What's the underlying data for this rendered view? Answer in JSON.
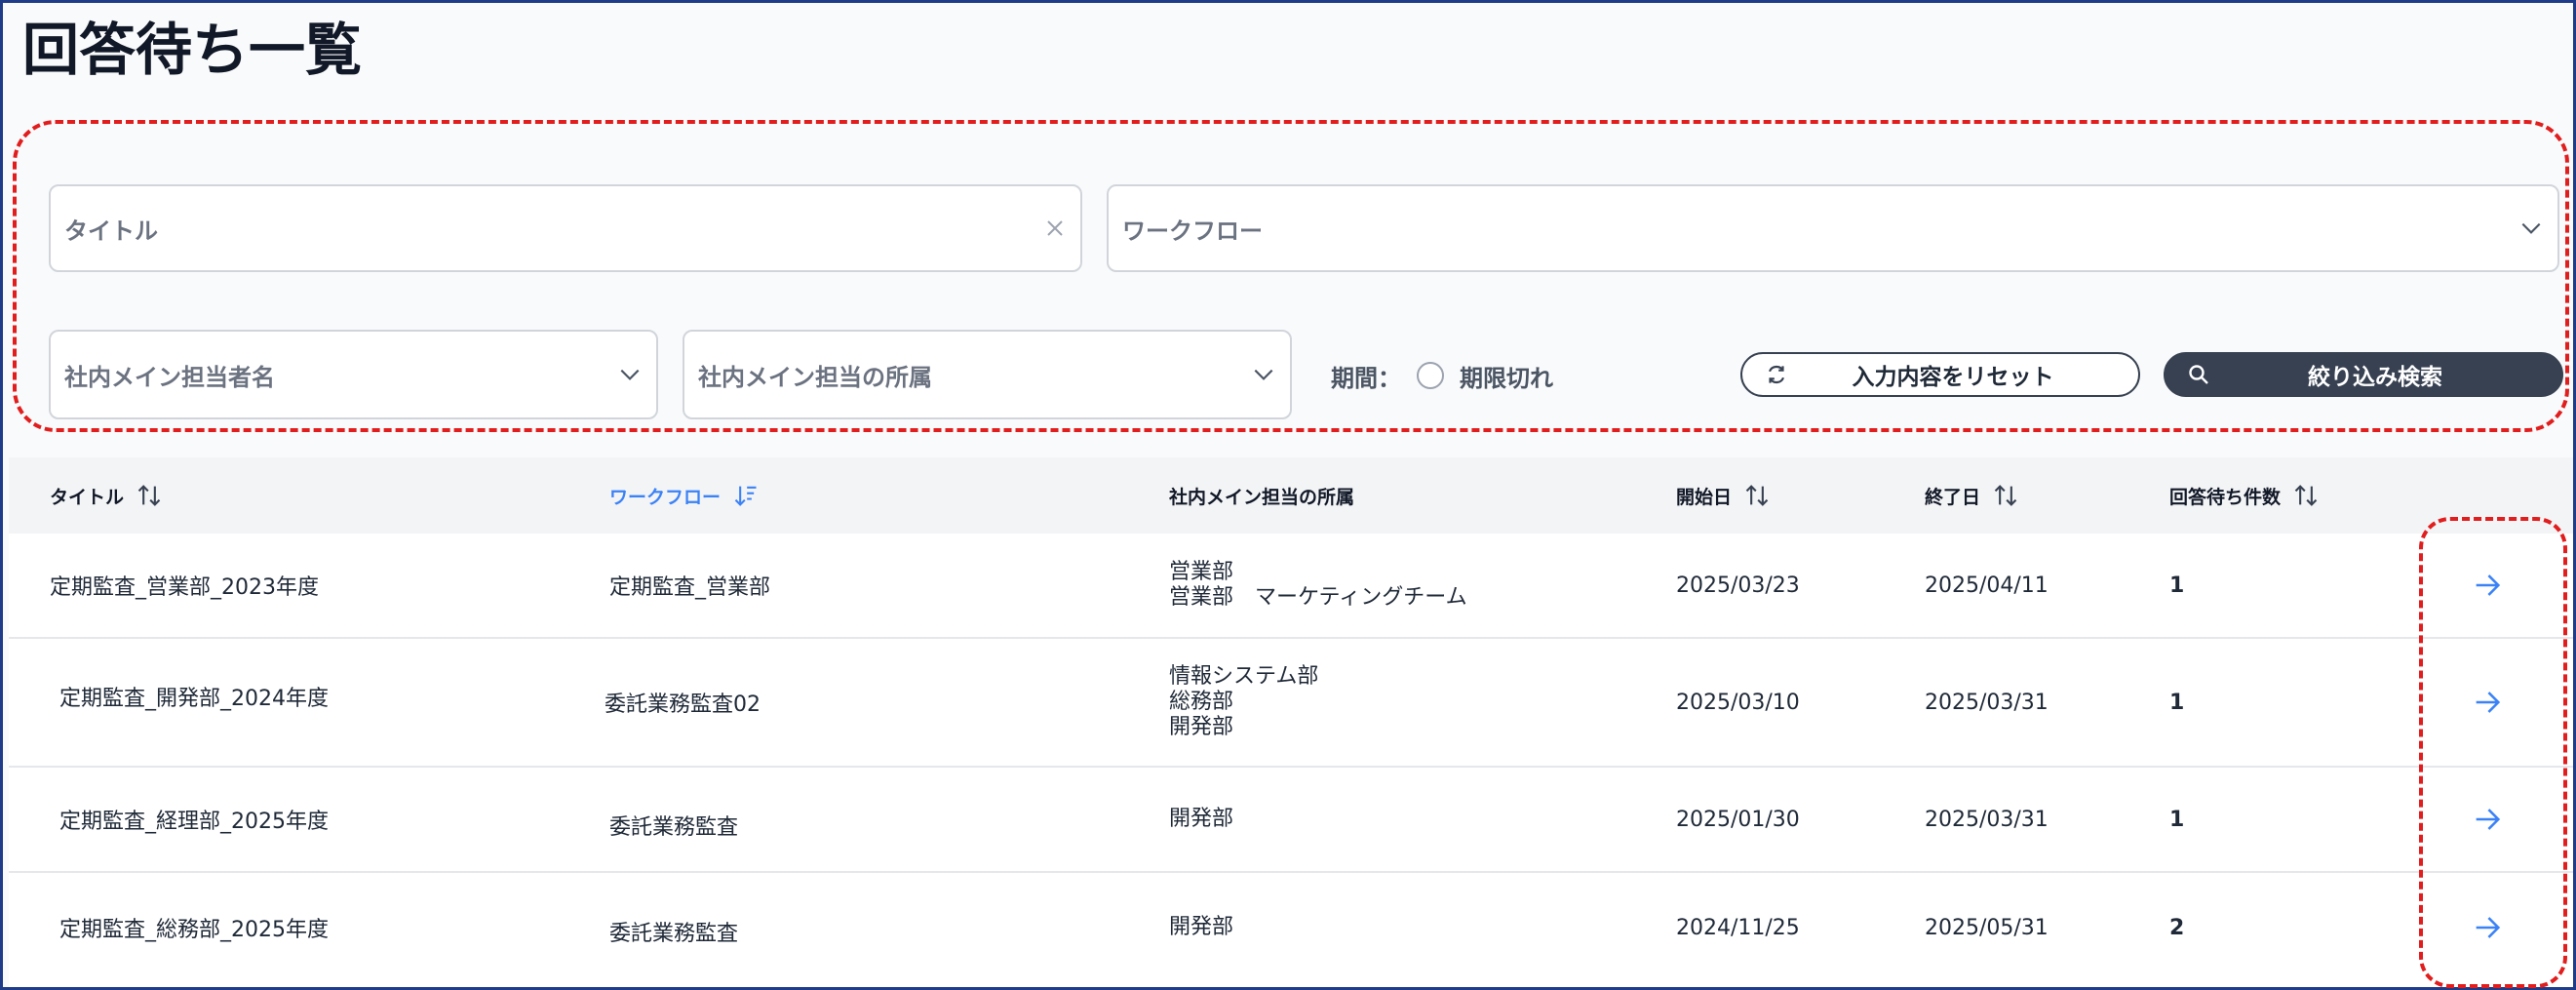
{
  "page": {
    "title": "回答待ち一覧"
  },
  "filters": {
    "title_placeholder": "タイトル",
    "workflow_placeholder": "ワークフロー",
    "owner_placeholder": "社内メイン担当者名",
    "dept_placeholder": "社内メイン担当の所属",
    "period_label": "期間：",
    "expired_label": "期限切れ",
    "reset_label": "入力内容をリセット",
    "search_label": "絞り込み検索"
  },
  "table": {
    "headers": {
      "title": "タイトル",
      "workflow": "ワークフロー",
      "dept": "社内メイン担当の所属",
      "start": "開始日",
      "end": "終了日",
      "count": "回答待ち件数"
    },
    "rows": [
      {
        "title": "定期監査_営業部_2023年度",
        "workflow": "定期監査_営業部",
        "depts": [
          "営業部",
          "営業部　マーケティングチーム"
        ],
        "start": "2025/03/23",
        "end": "2025/04/11",
        "count": "1"
      },
      {
        "title": "定期監査_開発部_2024年度",
        "workflow": "委託業務監査02",
        "depts": [
          "情報システム部",
          "総務部",
          "開発部"
        ],
        "start": "2025/03/10",
        "end": "2025/03/31",
        "count": "1"
      },
      {
        "title": "定期監査_経理部_2025年度",
        "workflow": "委託業務監査",
        "depts": [
          "開発部"
        ],
        "start": "2025/01/30",
        "end": "2025/03/31",
        "count": "1"
      },
      {
        "title": "定期監査_総務部_2025年度",
        "workflow": "委託業務監査",
        "depts": [
          "開発部"
        ],
        "start": "2024/11/25",
        "end": "2025/05/31",
        "count": "2"
      }
    ]
  },
  "icons": {
    "clear": "close-icon",
    "dropdown": "chevron-down-icon",
    "sort": "sort-icon",
    "sort_active": "sort-desc-icon",
    "reset": "refresh-icon",
    "search": "search-icon",
    "row_action": "arrow-right-icon"
  },
  "colors": {
    "accent": "#3b82f6",
    "primary_button": "#374151",
    "annotation": "#e11d1d",
    "frame": "#1f3c88"
  }
}
